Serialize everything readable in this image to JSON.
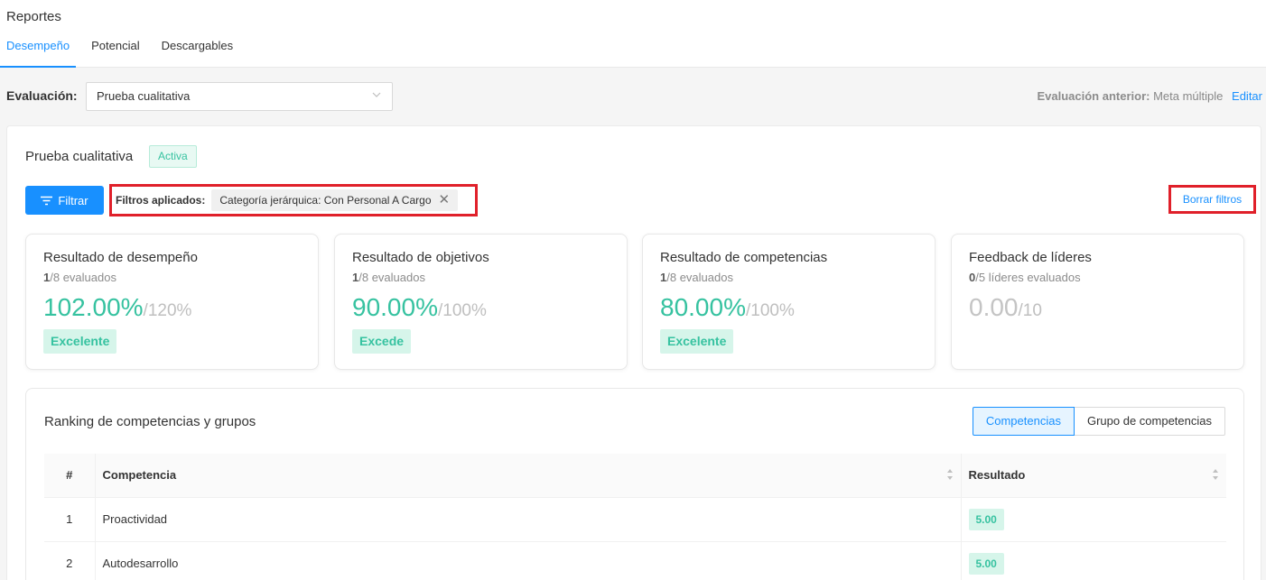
{
  "header": {
    "title": "Reportes",
    "tabs": [
      {
        "label": "Desempeño"
      },
      {
        "label": "Potencial"
      },
      {
        "label": "Descargables"
      }
    ]
  },
  "evaluation": {
    "label": "Evaluación:",
    "selected": "Prueba cualitativa",
    "previous_label": "Evaluación anterior:",
    "previous_value": "Meta múltiple",
    "edit_label": "Editar"
  },
  "card": {
    "title": "Prueba cualitativa",
    "status": "Activa"
  },
  "filters": {
    "button_label": "Filtrar",
    "applied_label": "Filtros aplicados:",
    "chip": "Categoría jerárquica: Con Personal A Cargo",
    "clear_label": "Borrar filtros"
  },
  "metrics": [
    {
      "title": "Resultado de desempeño",
      "count": "1",
      "sub": "/8 evaluados",
      "value": "102.00%",
      "of": "/120%",
      "badge": "Excelente"
    },
    {
      "title": "Resultado de objetivos",
      "count": "1",
      "sub": "/8 evaluados",
      "value": "90.00%",
      "of": "/100%",
      "badge": "Excede"
    },
    {
      "title": "Resultado de competencias",
      "count": "1",
      "sub": "/8 evaluados",
      "value": "80.00%",
      "of": "/100%",
      "badge": "Excelente"
    },
    {
      "title": "Feedback de líderes",
      "count": "0",
      "sub": "/5 líderes evaluados",
      "value": "0.00",
      "of": "/10",
      "badge": ""
    }
  ],
  "ranking": {
    "title": "Ranking de competencias y grupos",
    "toggle": [
      "Competencias",
      "Grupo de competencias"
    ],
    "columns": [
      "#",
      "Competencia",
      "Resultado"
    ],
    "rows": [
      {
        "num": "1",
        "name": "Proactividad",
        "score": "5.00"
      },
      {
        "num": "2",
        "name": "Autodesarrollo",
        "score": "5.00"
      }
    ]
  },
  "colors": {
    "accent": "#1890ff",
    "success": "#36c2a0",
    "highlight": "#e0202a"
  }
}
